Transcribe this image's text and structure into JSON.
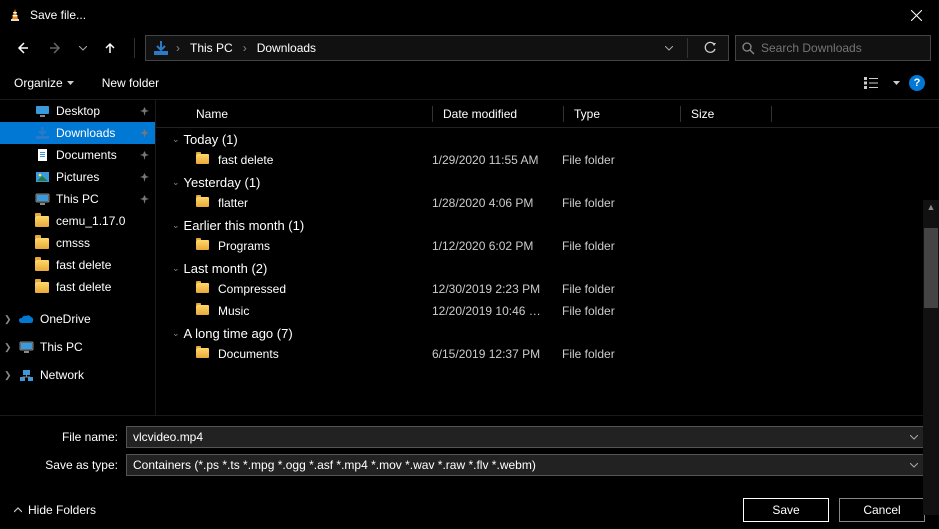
{
  "title": "Save file...",
  "breadcrumb": {
    "seg1": "This PC",
    "seg2": "Downloads"
  },
  "search": {
    "placeholder": "Search Downloads"
  },
  "toolbar": {
    "organize": "Organize",
    "new_folder": "New folder"
  },
  "columns": {
    "name": "Name",
    "date": "Date modified",
    "type": "Type",
    "size": "Size"
  },
  "sidebar": [
    {
      "label": "Desktop",
      "icon": "desktop",
      "pin": true
    },
    {
      "label": "Downloads",
      "icon": "downloads",
      "pin": true,
      "selected": true
    },
    {
      "label": "Documents",
      "icon": "documents",
      "pin": true
    },
    {
      "label": "Pictures",
      "icon": "pictures",
      "pin": true
    },
    {
      "label": "This PC",
      "icon": "thispc",
      "pin": true
    },
    {
      "label": "cemu_1.17.0",
      "icon": "folder"
    },
    {
      "label": "cmsss",
      "icon": "folder"
    },
    {
      "label": "fast delete",
      "icon": "folder"
    },
    {
      "label": "fast delete",
      "icon": "folder"
    }
  ],
  "sidebar_roots": [
    {
      "label": "OneDrive",
      "icon": "onedrive"
    },
    {
      "label": "This PC",
      "icon": "thispc"
    },
    {
      "label": "Network",
      "icon": "network"
    }
  ],
  "groups": [
    {
      "title": "Today (1)",
      "items": [
        {
          "name": "fast delete",
          "date": "1/29/2020 11:55 AM",
          "type": "File folder"
        }
      ]
    },
    {
      "title": "Yesterday (1)",
      "items": [
        {
          "name": "flatter",
          "date": "1/28/2020 4:06 PM",
          "type": "File folder"
        }
      ]
    },
    {
      "title": "Earlier this month (1)",
      "items": [
        {
          "name": "Programs",
          "date": "1/12/2020 6:02 PM",
          "type": "File folder"
        }
      ]
    },
    {
      "title": "Last month (2)",
      "items": [
        {
          "name": "Compressed",
          "date": "12/30/2019 2:23 PM",
          "type": "File folder"
        },
        {
          "name": "Music",
          "date": "12/20/2019 10:46 …",
          "type": "File folder"
        }
      ]
    },
    {
      "title": "A long time ago (7)",
      "items": [
        {
          "name": "Documents",
          "date": "6/15/2019 12:37 PM",
          "type": "File folder"
        }
      ]
    }
  ],
  "fields": {
    "filename_label": "File name:",
    "filename_value": "vlcvideo.mp4",
    "saveas_label": "Save as type:",
    "saveas_value": "Containers (*.ps *.ts *.mpg *.ogg *.asf *.mp4 *.mov *.wav *.raw *.flv *.webm)"
  },
  "footer": {
    "hide": "Hide Folders",
    "save": "Save",
    "cancel": "Cancel"
  }
}
